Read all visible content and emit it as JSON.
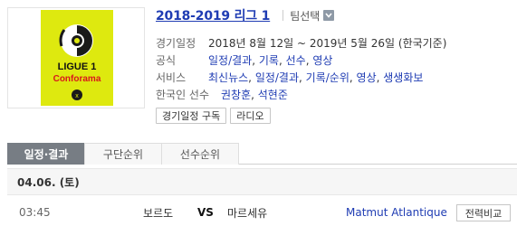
{
  "league": {
    "title": "2018-2019 리그 1",
    "team_select_label": "팀선택",
    "logo": {
      "line1": "LIGUE 1",
      "line2": "Conforama",
      "bg_color": "#dee90f"
    }
  },
  "info": {
    "schedule_label": "경기일정",
    "schedule_value": "2018년 8월 12일 ~ 2019년 5월 26일 (한국기준)",
    "official_label": "공식",
    "official_links": [
      "일정/결과",
      "기록",
      "선수",
      "영상"
    ],
    "service_label": "서비스",
    "service_links": [
      "최신뉴스",
      "일정/결과",
      "기록/순위",
      "영상",
      "생생화보"
    ],
    "korean_label": "한국인 선수",
    "korean_players": [
      "권창훈",
      "석현준"
    ]
  },
  "buttons": {
    "subscribe": "경기일정 구독",
    "radio": "라디오"
  },
  "tabs": [
    "일정·결과",
    "구단순위",
    "선수순위"
  ],
  "date_header": "04.06. (토)",
  "match": {
    "time": "03:45",
    "home": "보르도",
    "vs": "VS",
    "away": "마르세유",
    "venue": "Matmut Atlantique",
    "compare": "전력비교"
  },
  "colors": {
    "link": "#1f3cb3",
    "active_tab": "#777d84"
  }
}
